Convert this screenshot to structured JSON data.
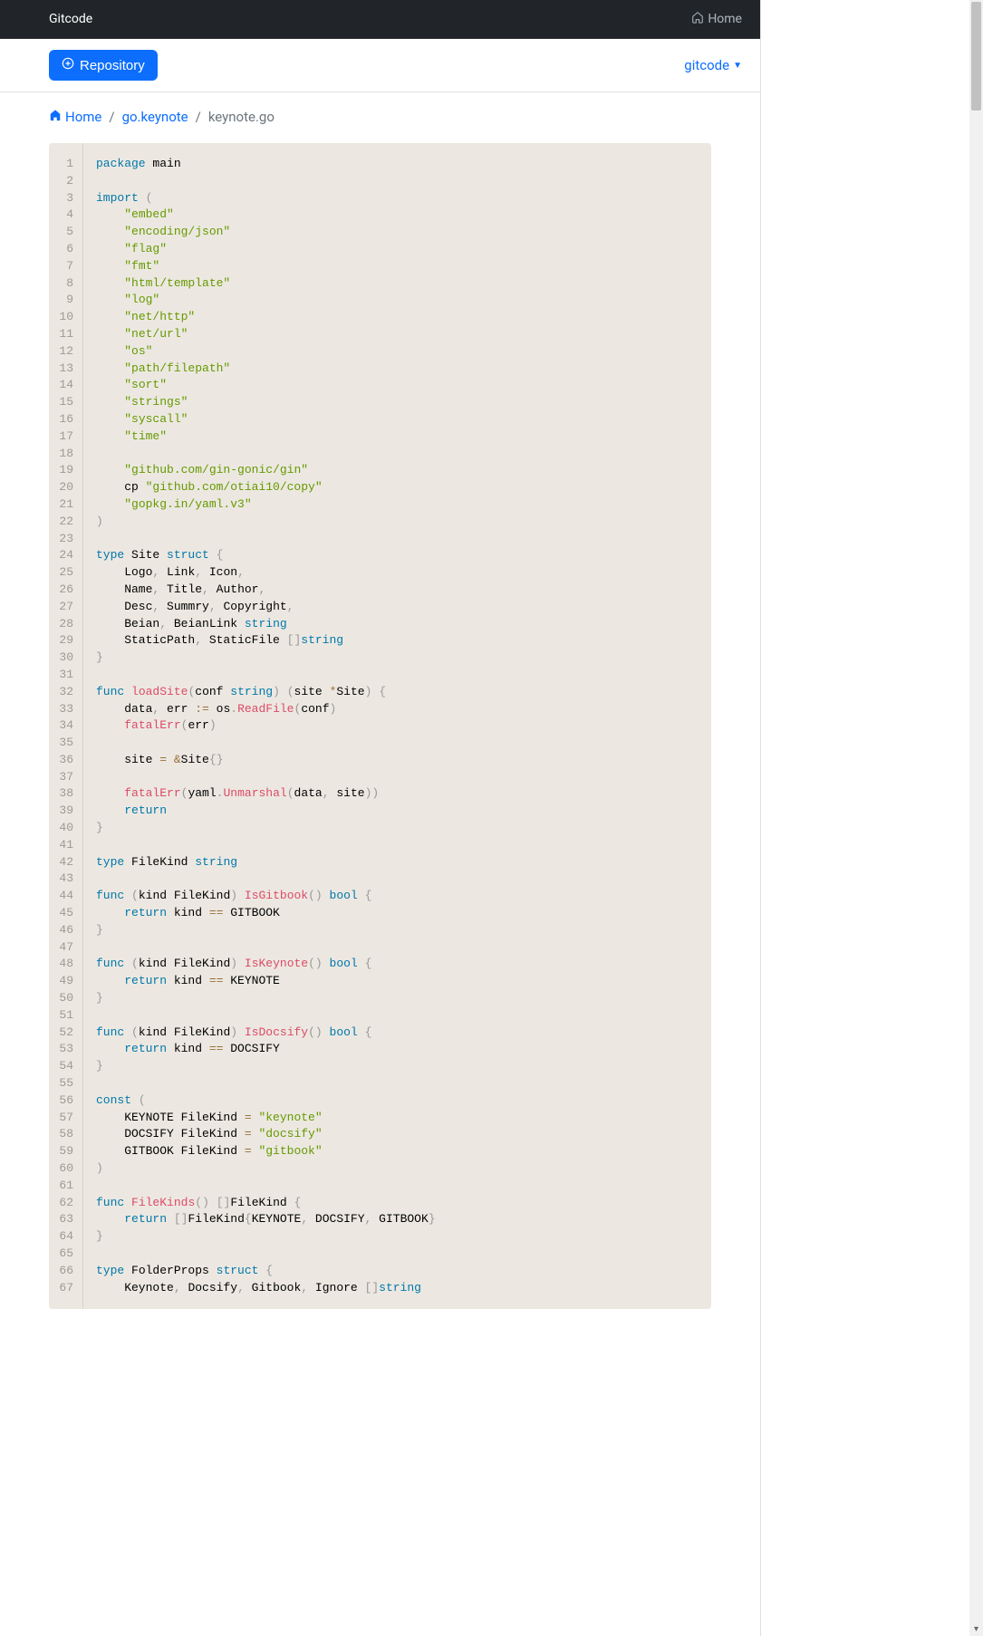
{
  "navbar": {
    "brand": "Gitcode",
    "home_label": "Home"
  },
  "subheader": {
    "repository_button": "Repository",
    "dropdown_label": "gitcode"
  },
  "breadcrumb": {
    "home": "Home",
    "path1": "go.keynote",
    "current": "keynote.go"
  },
  "code": {
    "line_count": 67,
    "lines": [
      [
        [
          "kw",
          "package"
        ],
        [
          "plain",
          " main"
        ]
      ],
      [],
      [
        [
          "kw",
          "import"
        ],
        [
          "plain",
          " "
        ],
        [
          "paren",
          "("
        ]
      ],
      [
        [
          "plain",
          "    "
        ],
        [
          "str",
          "\"embed\""
        ]
      ],
      [
        [
          "plain",
          "    "
        ],
        [
          "str",
          "\"encoding/json\""
        ]
      ],
      [
        [
          "plain",
          "    "
        ],
        [
          "str",
          "\"flag\""
        ]
      ],
      [
        [
          "plain",
          "    "
        ],
        [
          "str",
          "\"fmt\""
        ]
      ],
      [
        [
          "plain",
          "    "
        ],
        [
          "str",
          "\"html/template\""
        ]
      ],
      [
        [
          "plain",
          "    "
        ],
        [
          "str",
          "\"log\""
        ]
      ],
      [
        [
          "plain",
          "    "
        ],
        [
          "str",
          "\"net/http\""
        ]
      ],
      [
        [
          "plain",
          "    "
        ],
        [
          "str",
          "\"net/url\""
        ]
      ],
      [
        [
          "plain",
          "    "
        ],
        [
          "str",
          "\"os\""
        ]
      ],
      [
        [
          "plain",
          "    "
        ],
        [
          "str",
          "\"path/filepath\""
        ]
      ],
      [
        [
          "plain",
          "    "
        ],
        [
          "str",
          "\"sort\""
        ]
      ],
      [
        [
          "plain",
          "    "
        ],
        [
          "str",
          "\"strings\""
        ]
      ],
      [
        [
          "plain",
          "    "
        ],
        [
          "str",
          "\"syscall\""
        ]
      ],
      [
        [
          "plain",
          "    "
        ],
        [
          "str",
          "\"time\""
        ]
      ],
      [],
      [
        [
          "plain",
          "    "
        ],
        [
          "str",
          "\"github.com/gin-gonic/gin\""
        ]
      ],
      [
        [
          "plain",
          "    cp "
        ],
        [
          "str",
          "\"github.com/otiai10/copy\""
        ]
      ],
      [
        [
          "plain",
          "    "
        ],
        [
          "str",
          "\"gopkg.in/yaml.v3\""
        ]
      ],
      [
        [
          "paren",
          ")"
        ]
      ],
      [],
      [
        [
          "kw",
          "type"
        ],
        [
          "plain",
          " Site "
        ],
        [
          "kw",
          "struct"
        ],
        [
          "plain",
          " "
        ],
        [
          "paren",
          "{"
        ]
      ],
      [
        [
          "plain",
          "    Logo"
        ],
        [
          "paren",
          ","
        ],
        [
          "plain",
          " Link"
        ],
        [
          "paren",
          ","
        ],
        [
          "plain",
          " Icon"
        ],
        [
          "paren",
          ","
        ]
      ],
      [
        [
          "plain",
          "    Name"
        ],
        [
          "paren",
          ","
        ],
        [
          "plain",
          " Title"
        ],
        [
          "paren",
          ","
        ],
        [
          "plain",
          " Author"
        ],
        [
          "paren",
          ","
        ]
      ],
      [
        [
          "plain",
          "    Desc"
        ],
        [
          "paren",
          ","
        ],
        [
          "plain",
          " Summry"
        ],
        [
          "paren",
          ","
        ],
        [
          "plain",
          " Copyright"
        ],
        [
          "paren",
          ","
        ]
      ],
      [
        [
          "plain",
          "    Beian"
        ],
        [
          "paren",
          ","
        ],
        [
          "plain",
          " BeianLink "
        ],
        [
          "kw",
          "string"
        ]
      ],
      [
        [
          "plain",
          "    StaticPath"
        ],
        [
          "paren",
          ","
        ],
        [
          "plain",
          " StaticFile "
        ],
        [
          "paren",
          "["
        ],
        [
          "paren",
          "]"
        ],
        [
          "kw",
          "string"
        ]
      ],
      [
        [
          "paren",
          "}"
        ]
      ],
      [],
      [
        [
          "kw",
          "func"
        ],
        [
          "plain",
          " "
        ],
        [
          "fn",
          "loadSite"
        ],
        [
          "paren",
          "("
        ],
        [
          "plain",
          "conf "
        ],
        [
          "kw",
          "string"
        ],
        [
          "paren",
          ")"
        ],
        [
          "plain",
          " "
        ],
        [
          "paren",
          "("
        ],
        [
          "plain",
          "site "
        ],
        [
          "op",
          "*"
        ],
        [
          "plain",
          "Site"
        ],
        [
          "paren",
          ")"
        ],
        [
          "plain",
          " "
        ],
        [
          "paren",
          "{"
        ]
      ],
      [
        [
          "plain",
          "    data"
        ],
        [
          "paren",
          ","
        ],
        [
          "plain",
          " err "
        ],
        [
          "op",
          ":="
        ],
        [
          "plain",
          " os"
        ],
        [
          "paren",
          "."
        ],
        [
          "fn",
          "ReadFile"
        ],
        [
          "paren",
          "("
        ],
        [
          "plain",
          "conf"
        ],
        [
          "paren",
          ")"
        ]
      ],
      [
        [
          "plain",
          "    "
        ],
        [
          "fn",
          "fatalErr"
        ],
        [
          "paren",
          "("
        ],
        [
          "plain",
          "err"
        ],
        [
          "paren",
          ")"
        ]
      ],
      [],
      [
        [
          "plain",
          "    site "
        ],
        [
          "op",
          "="
        ],
        [
          "plain",
          " "
        ],
        [
          "op",
          "&"
        ],
        [
          "plain",
          "Site"
        ],
        [
          "paren",
          "{"
        ],
        [
          "paren",
          "}"
        ]
      ],
      [],
      [
        [
          "plain",
          "    "
        ],
        [
          "fn",
          "fatalErr"
        ],
        [
          "paren",
          "("
        ],
        [
          "plain",
          "yaml"
        ],
        [
          "paren",
          "."
        ],
        [
          "fn",
          "Unmarshal"
        ],
        [
          "paren",
          "("
        ],
        [
          "plain",
          "data"
        ],
        [
          "paren",
          ","
        ],
        [
          "plain",
          " site"
        ],
        [
          "paren",
          ")"
        ],
        [
          "paren",
          ")"
        ]
      ],
      [
        [
          "plain",
          "    "
        ],
        [
          "kw",
          "return"
        ]
      ],
      [
        [
          "paren",
          "}"
        ]
      ],
      [],
      [
        [
          "kw",
          "type"
        ],
        [
          "plain",
          " FileKind "
        ],
        [
          "kw",
          "string"
        ]
      ],
      [],
      [
        [
          "kw",
          "func"
        ],
        [
          "plain",
          " "
        ],
        [
          "paren",
          "("
        ],
        [
          "plain",
          "kind FileKind"
        ],
        [
          "paren",
          ")"
        ],
        [
          "plain",
          " "
        ],
        [
          "fn",
          "IsGitbook"
        ],
        [
          "paren",
          "("
        ],
        [
          "paren",
          ")"
        ],
        [
          "plain",
          " "
        ],
        [
          "kw",
          "bool"
        ],
        [
          "plain",
          " "
        ],
        [
          "paren",
          "{"
        ]
      ],
      [
        [
          "plain",
          "    "
        ],
        [
          "kw",
          "return"
        ],
        [
          "plain",
          " kind "
        ],
        [
          "op",
          "=="
        ],
        [
          "plain",
          " GITBOOK"
        ]
      ],
      [
        [
          "paren",
          "}"
        ]
      ],
      [],
      [
        [
          "kw",
          "func"
        ],
        [
          "plain",
          " "
        ],
        [
          "paren",
          "("
        ],
        [
          "plain",
          "kind FileKind"
        ],
        [
          "paren",
          ")"
        ],
        [
          "plain",
          " "
        ],
        [
          "fn",
          "IsKeynote"
        ],
        [
          "paren",
          "("
        ],
        [
          "paren",
          ")"
        ],
        [
          "plain",
          " "
        ],
        [
          "kw",
          "bool"
        ],
        [
          "plain",
          " "
        ],
        [
          "paren",
          "{"
        ]
      ],
      [
        [
          "plain",
          "    "
        ],
        [
          "kw",
          "return"
        ],
        [
          "plain",
          " kind "
        ],
        [
          "op",
          "=="
        ],
        [
          "plain",
          " KEYNOTE"
        ]
      ],
      [
        [
          "paren",
          "}"
        ]
      ],
      [],
      [
        [
          "kw",
          "func"
        ],
        [
          "plain",
          " "
        ],
        [
          "paren",
          "("
        ],
        [
          "plain",
          "kind FileKind"
        ],
        [
          "paren",
          ")"
        ],
        [
          "plain",
          " "
        ],
        [
          "fn",
          "IsDocsify"
        ],
        [
          "paren",
          "("
        ],
        [
          "paren",
          ")"
        ],
        [
          "plain",
          " "
        ],
        [
          "kw",
          "bool"
        ],
        [
          "plain",
          " "
        ],
        [
          "paren",
          "{"
        ]
      ],
      [
        [
          "plain",
          "    "
        ],
        [
          "kw",
          "return"
        ],
        [
          "plain",
          " kind "
        ],
        [
          "op",
          "=="
        ],
        [
          "plain",
          " DOCSIFY"
        ]
      ],
      [
        [
          "paren",
          "}"
        ]
      ],
      [],
      [
        [
          "kw",
          "const"
        ],
        [
          "plain",
          " "
        ],
        [
          "paren",
          "("
        ]
      ],
      [
        [
          "plain",
          "    KEYNOTE FileKind "
        ],
        [
          "op",
          "="
        ],
        [
          "plain",
          " "
        ],
        [
          "str",
          "\"keynote\""
        ]
      ],
      [
        [
          "plain",
          "    DOCSIFY FileKind "
        ],
        [
          "op",
          "="
        ],
        [
          "plain",
          " "
        ],
        [
          "str",
          "\"docsify\""
        ]
      ],
      [
        [
          "plain",
          "    GITBOOK FileKind "
        ],
        [
          "op",
          "="
        ],
        [
          "plain",
          " "
        ],
        [
          "str",
          "\"gitbook\""
        ]
      ],
      [
        [
          "paren",
          ")"
        ]
      ],
      [],
      [
        [
          "kw",
          "func"
        ],
        [
          "plain",
          " "
        ],
        [
          "fn",
          "FileKinds"
        ],
        [
          "paren",
          "("
        ],
        [
          "paren",
          ")"
        ],
        [
          "plain",
          " "
        ],
        [
          "paren",
          "["
        ],
        [
          "paren",
          "]"
        ],
        [
          "plain",
          "FileKind "
        ],
        [
          "paren",
          "{"
        ]
      ],
      [
        [
          "plain",
          "    "
        ],
        [
          "kw",
          "return"
        ],
        [
          "plain",
          " "
        ],
        [
          "paren",
          "["
        ],
        [
          "paren",
          "]"
        ],
        [
          "plain",
          "FileKind"
        ],
        [
          "paren",
          "{"
        ],
        [
          "plain",
          "KEYNOTE"
        ],
        [
          "paren",
          ","
        ],
        [
          "plain",
          " DOCSIFY"
        ],
        [
          "paren",
          ","
        ],
        [
          "plain",
          " GITBOOK"
        ],
        [
          "paren",
          "}"
        ]
      ],
      [
        [
          "paren",
          "}"
        ]
      ],
      [],
      [
        [
          "kw",
          "type"
        ],
        [
          "plain",
          " FolderProps "
        ],
        [
          "kw",
          "struct"
        ],
        [
          "plain",
          " "
        ],
        [
          "paren",
          "{"
        ]
      ],
      [
        [
          "plain",
          "    Keynote"
        ],
        [
          "paren",
          ","
        ],
        [
          "plain",
          " Docsify"
        ],
        [
          "paren",
          ","
        ],
        [
          "plain",
          " Gitbook"
        ],
        [
          "paren",
          ","
        ],
        [
          "plain",
          " Ignore "
        ],
        [
          "paren",
          "["
        ],
        [
          "paren",
          "]"
        ],
        [
          "kw",
          "string"
        ]
      ]
    ]
  }
}
